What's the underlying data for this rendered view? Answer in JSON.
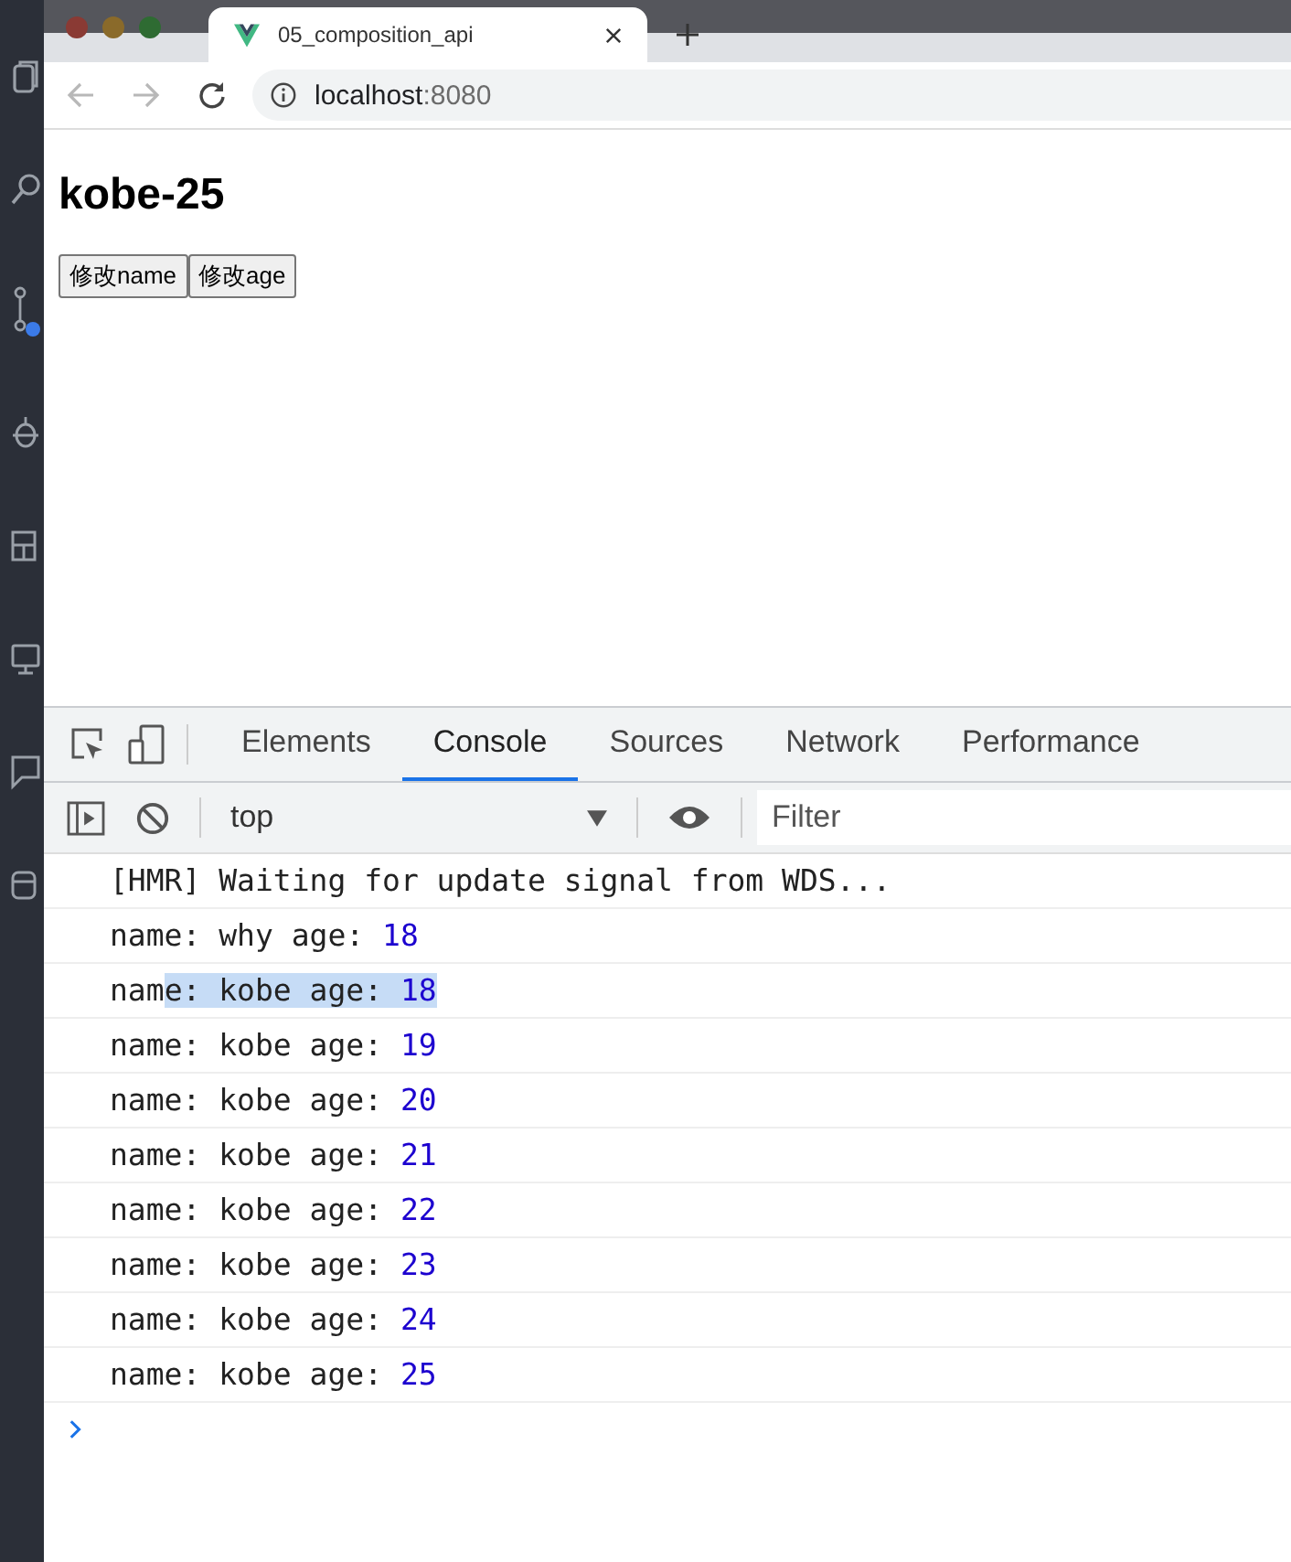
{
  "browser": {
    "tab": {
      "title": "05_composition_api"
    },
    "address": {
      "host": "localhost",
      "port": ":8080"
    }
  },
  "page": {
    "heading": "kobe-25",
    "buttons": [
      "修改name",
      "修改age"
    ]
  },
  "devtools": {
    "tabs": [
      {
        "label": "Elements",
        "selected": false
      },
      {
        "label": "Console",
        "selected": true
      },
      {
        "label": "Sources",
        "selected": false
      },
      {
        "label": "Network",
        "selected": false
      },
      {
        "label": "Performance",
        "selected": false
      }
    ],
    "context": "top",
    "filter": {
      "placeholder": "Filter"
    },
    "messages": [
      {
        "parts": [
          {
            "text": "[HMR] Waiting for update signal from WDS...",
            "kind": "text",
            "selected": false
          }
        ]
      },
      {
        "parts": [
          {
            "text": "name: why age: ",
            "kind": "text",
            "selected": false
          },
          {
            "text": "18",
            "kind": "number",
            "selected": false
          }
        ]
      },
      {
        "parts": [
          {
            "text": "nam",
            "kind": "text",
            "selected": false
          },
          {
            "text": "e: kobe age: ",
            "kind": "text",
            "selected": true
          },
          {
            "text": "18",
            "kind": "number",
            "selected": true
          }
        ]
      },
      {
        "parts": [
          {
            "text": "name: kobe age: ",
            "kind": "text",
            "selected": false
          },
          {
            "text": "19",
            "kind": "number",
            "selected": false
          }
        ]
      },
      {
        "parts": [
          {
            "text": "name: kobe age: ",
            "kind": "text",
            "selected": false
          },
          {
            "text": "20",
            "kind": "number",
            "selected": false
          }
        ]
      },
      {
        "parts": [
          {
            "text": "name: kobe age: ",
            "kind": "text",
            "selected": false
          },
          {
            "text": "21",
            "kind": "number",
            "selected": false
          }
        ]
      },
      {
        "parts": [
          {
            "text": "name: kobe age: ",
            "kind": "text",
            "selected": false
          },
          {
            "text": "22",
            "kind": "number",
            "selected": false
          }
        ]
      },
      {
        "parts": [
          {
            "text": "name: kobe age: ",
            "kind": "text",
            "selected": false
          },
          {
            "text": "23",
            "kind": "number",
            "selected": false
          }
        ]
      },
      {
        "parts": [
          {
            "text": "name: kobe age: ",
            "kind": "text",
            "selected": false
          },
          {
            "text": "24",
            "kind": "number",
            "selected": false
          }
        ]
      },
      {
        "parts": [
          {
            "text": "name: kobe age: ",
            "kind": "text",
            "selected": false
          },
          {
            "text": "25",
            "kind": "number",
            "selected": false
          }
        ]
      }
    ]
  }
}
